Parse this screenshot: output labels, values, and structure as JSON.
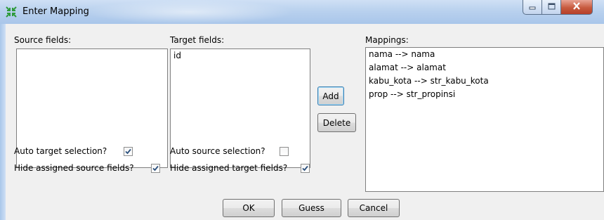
{
  "window": {
    "title": "Enter Mapping",
    "icon": "mapping-arrows-icon",
    "caption_buttons": [
      "minimize-icon",
      "maximize-icon",
      "close-icon"
    ]
  },
  "source": {
    "label": "Source fields:",
    "items": []
  },
  "target": {
    "label": "Target fields:",
    "items": [
      "id"
    ]
  },
  "mappings": {
    "label": "Mappings:",
    "items": [
      "nama --> nama",
      "alamat --> alamat",
      "kabu_kota --> str_kabu_kota",
      "prop --> str_propinsi"
    ]
  },
  "middle_buttons": {
    "add": "Add",
    "delete": "Delete"
  },
  "options": {
    "auto_target_label": "Auto target selection?",
    "auto_target_checked": true,
    "hide_source_label": "Hide assigned source fields?",
    "hide_source_checked": true,
    "auto_source_label": "Auto source selection?",
    "auto_source_checked": false,
    "hide_target_label": "Hide assigned target fields?",
    "hide_target_checked": true
  },
  "footer": {
    "ok": "OK",
    "guess": "Guess",
    "cancel": "Cancel"
  },
  "colors": {
    "title_bar": "#b9d1ee",
    "close_button": "#c75a3e",
    "focus_border": "#3c7fb1"
  }
}
